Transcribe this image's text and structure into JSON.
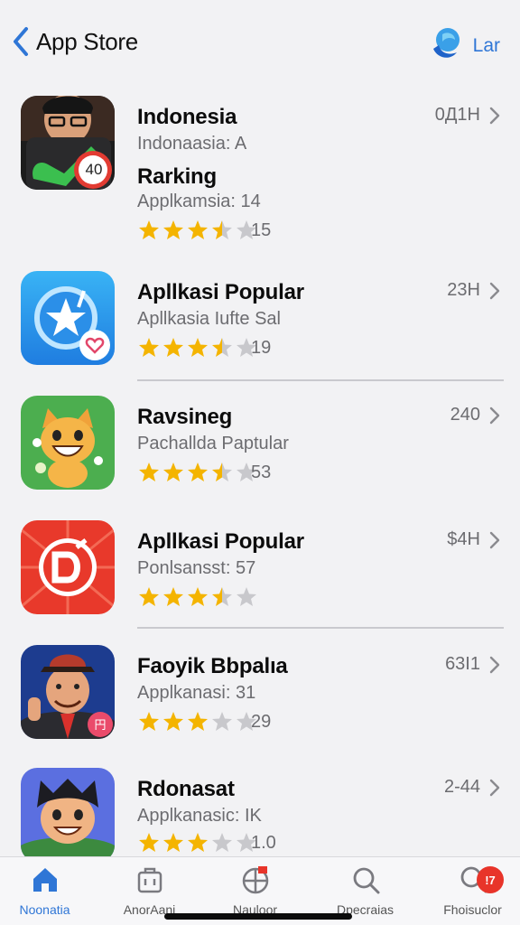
{
  "nav": {
    "back_label": "App Store",
    "right_label": "Lar"
  },
  "apps": [
    {
      "title": "Indonesia",
      "subtitle": "Indonaasia: A",
      "meta": "0Д1Н",
      "icon": "portrait-chart-icon",
      "badge": "40",
      "extra_title": "Rarking",
      "extra_subtitle": "Applkamsia: 14",
      "rating": 3.5,
      "rating_count": "15"
    },
    {
      "title": "Apllkasi Popular",
      "subtitle": "Apllkasia Iufte Sal",
      "meta": "23H",
      "icon": "compass-star-icon",
      "rating": 3.5,
      "rating_count": "19"
    },
    {
      "title": "Ravsineg",
      "subtitle": "Pachallda Paptular",
      "meta": "240",
      "icon": "cat-mascot-icon",
      "rating": 3.5,
      "rating_count": "53"
    },
    {
      "title": "Apllkasi Popular",
      "subtitle": "Ponlsansst: 57",
      "meta": "$4H",
      "icon": "letter-d-icon",
      "rating": 3.5,
      "rating_count": ""
    },
    {
      "title": "Faoyik Bbpalıa",
      "subtitle": "Applkanasi: 31",
      "meta": "63I1",
      "icon": "man-hat-icon",
      "rating": 3,
      "rating_count": "29"
    },
    {
      "title": "Rdonasat",
      "subtitle": "Applkanasic: IK",
      "meta": "2-44",
      "icon": "cartoon-boy-icon",
      "rating": 3,
      "rating_count": "1.0"
    }
  ],
  "tabs": [
    {
      "label": "Noonatia",
      "icon": "home-icon",
      "active": true
    },
    {
      "label": "AnorAani",
      "icon": "briefcase-icon"
    },
    {
      "label": "Nauloor",
      "icon": "globe-icon"
    },
    {
      "label": "Dpecraias",
      "icon": "search-icon"
    },
    {
      "label": "Fhoisuclor",
      "icon": "profile-search-icon",
      "badge": "!7"
    }
  ],
  "colors": {
    "accent": "#2f76d6",
    "star": "#f4b400",
    "star_empty": "#c8c8cc",
    "badge": "#e8342a"
  }
}
